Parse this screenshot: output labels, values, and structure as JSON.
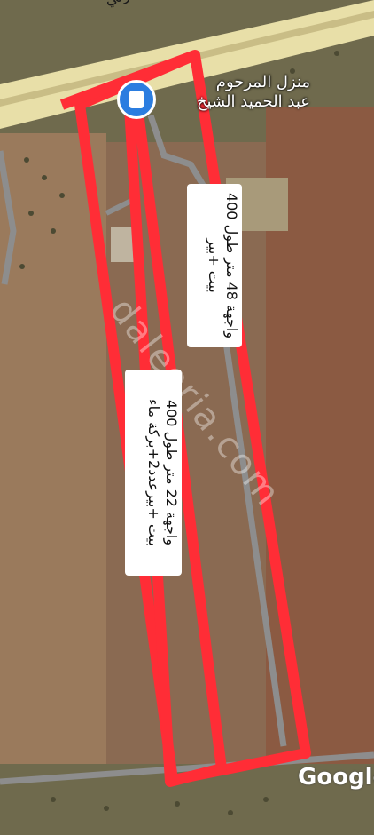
{
  "map": {
    "road_label": "طريق اتستراد دمشق الدولي",
    "place_name_line1": "منزل المرحوم",
    "place_name_line2": "عبد الحميد الشيخ",
    "watermark": "daleeria.com",
    "provider": "Google",
    "plots": [
      {
        "id": "plot-east",
        "label_line1": "واجهة 48 متر طول 400",
        "label_line2": "بيت +بير"
      },
      {
        "id": "plot-west",
        "label_line1": "واجهة 22 متر طول 400",
        "label_line2": "بيت +بيرعدد2+بركة ماء"
      }
    ],
    "colors": {
      "boundary": "#ff2d36",
      "road": "#e8dfa8",
      "field": "#8a6a52",
      "label_bg": "#ffffff"
    }
  }
}
